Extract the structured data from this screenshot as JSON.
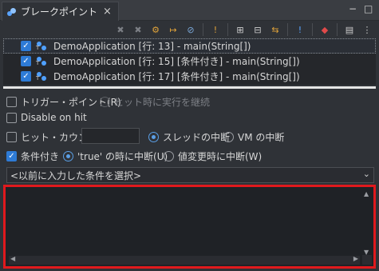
{
  "tab": {
    "title": "ブレークポイント",
    "close": "×"
  },
  "window_buttons": {
    "minimize": "−",
    "maximize": "□"
  },
  "toolbar": {
    "icons": [
      "remove-icon",
      "remove-all-icon",
      "link-icon",
      "import-icon",
      "export-icon",
      "skip-all-icon",
      "expand-all-icon",
      "collapse-all-icon",
      "link-with-debug-icon",
      "add-java-exception-icon",
      "toggle-exception-icon",
      "add-breakpoint-icon",
      "view-menu-icon"
    ]
  },
  "breakpoints": [
    {
      "text": "DemoApplication [行: 13] - main(String[])",
      "checked": true,
      "selected": true
    },
    {
      "text": "DemoApplication [行: 15] [条件付き] - main(String[])",
      "checked": true,
      "selected": false
    },
    {
      "text": "DemoApplication [行: 17] [条件付き] - main(String[])",
      "checked": true,
      "selected": false
    }
  ],
  "options": {
    "trigger_point": "トリガー・ポイント(R)",
    "resume_on_hit": "ヒット時に実行を継続",
    "disable_on_hit": "Disable on hit",
    "hit_count": "ヒット・カウント:",
    "hit_count_value": "",
    "suspend_thread": "スレッドの中断",
    "suspend_vm": "VM の中断",
    "conditional": "条件付き",
    "suspend_when_true": "'true' の時に中断(U)",
    "suspend_when_changed": "値変更時に中断(W)"
  },
  "condition_history": {
    "placeholder": "<以前に入力した条件を選択>"
  },
  "condition_editor": {
    "value": ""
  }
}
